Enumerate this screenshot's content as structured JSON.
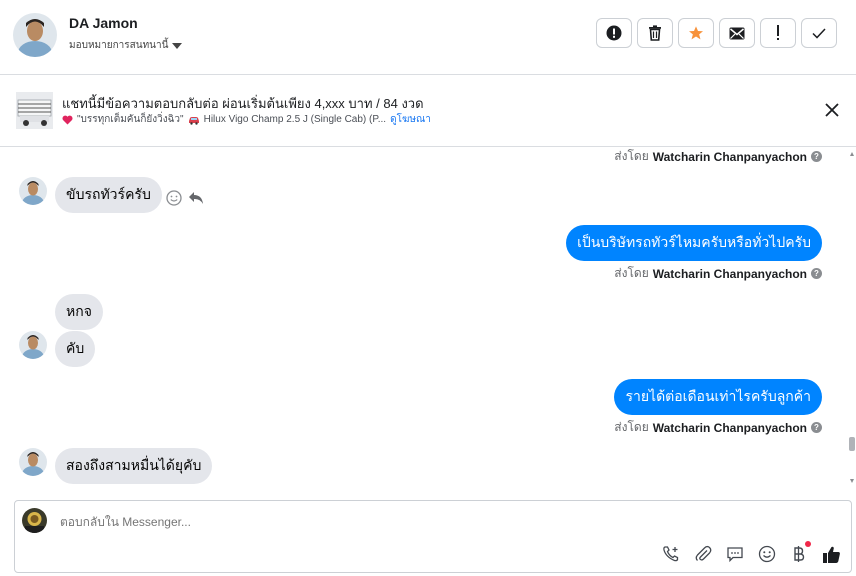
{
  "header": {
    "contact_name": "DA Jamon",
    "assign_label": "มอบหมายการสนทนานี้"
  },
  "actions": [
    {
      "name": "report-icon"
    },
    {
      "name": "trash-icon"
    },
    {
      "name": "star-icon",
      "color": "#f7923b"
    },
    {
      "name": "mail-icon"
    },
    {
      "name": "exclamation-icon"
    },
    {
      "name": "check-icon"
    }
  ],
  "ad": {
    "title": "แชทนี้มีข้อความตอบกลับต่อ ผ่อนเริ่มต้นเพียง 4,xxx บาท / 84 งวด",
    "sub_text": "\"บรรทุกเต็มคันก็ยังวิ่งฉิว\"",
    "vehicle": "Hilux Vigo Champ 2.5 J (Single Cab) (P...",
    "link": "ดูโฆษณา"
  },
  "messages": {
    "sent_by_prefix": "ส่งโดย",
    "sender_name": "Watcharin Chanpanyachon",
    "in_1": "ขับรถทัวร์ครับ",
    "out_1": "เป็นบริษัทรถทัวร์ไหมครับหรือทั่วไปครับ",
    "in_2": "หกจ",
    "in_3": "คับ",
    "out_2": "รายได้ต่อเดือนเท่าไรครับลูกค้า",
    "in_4": "สองถึงสามหมื่นได้ยุคับ"
  },
  "composer": {
    "placeholder": "ตอบกลับใน Messenger..."
  },
  "colors": {
    "accent": "#0084ff",
    "incoming_bubble": "#e4e6eb",
    "link": "#1877f2"
  }
}
